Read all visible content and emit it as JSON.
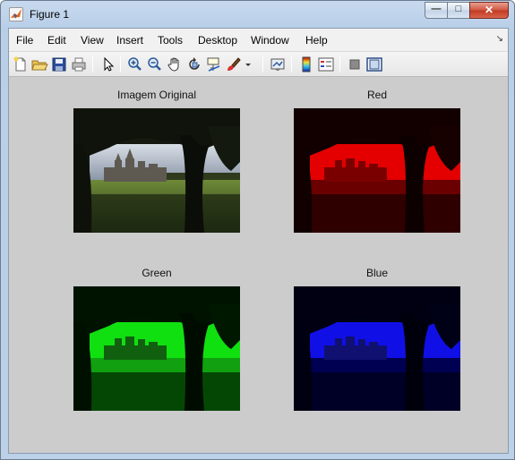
{
  "window": {
    "title": "Figure 1",
    "controls": {
      "minimize": "—",
      "maximize": "□",
      "close": "✕"
    }
  },
  "menubar": {
    "items": [
      "File",
      "Edit",
      "View",
      "Insert",
      "Tools",
      "Desktop",
      "Window",
      "Help"
    ],
    "overflow": "↘"
  },
  "toolbar": {
    "icons": [
      "new-figure-icon",
      "open-file-icon",
      "save-icon",
      "print-icon",
      "edit-plot-arrow-icon",
      "zoom-in-icon",
      "zoom-out-icon",
      "pan-hand-icon",
      "rotate-3d-icon",
      "data-cursor-icon",
      "brush-icon",
      "brush-dropdown-icon",
      "link-plot-icon",
      "insert-colorbar-icon",
      "insert-legend-icon",
      "hide-plot-tools-icon",
      "show-plot-tools-icon"
    ]
  },
  "subplots": [
    {
      "title": "Imagem Original",
      "channel": "original"
    },
    {
      "title": "Red",
      "channel": "red",
      "color": "#ff0000"
    },
    {
      "title": "Green",
      "channel": "green",
      "color": "#00ff00"
    },
    {
      "title": "Blue",
      "channel": "blue",
      "color": "#0000ff"
    }
  ]
}
